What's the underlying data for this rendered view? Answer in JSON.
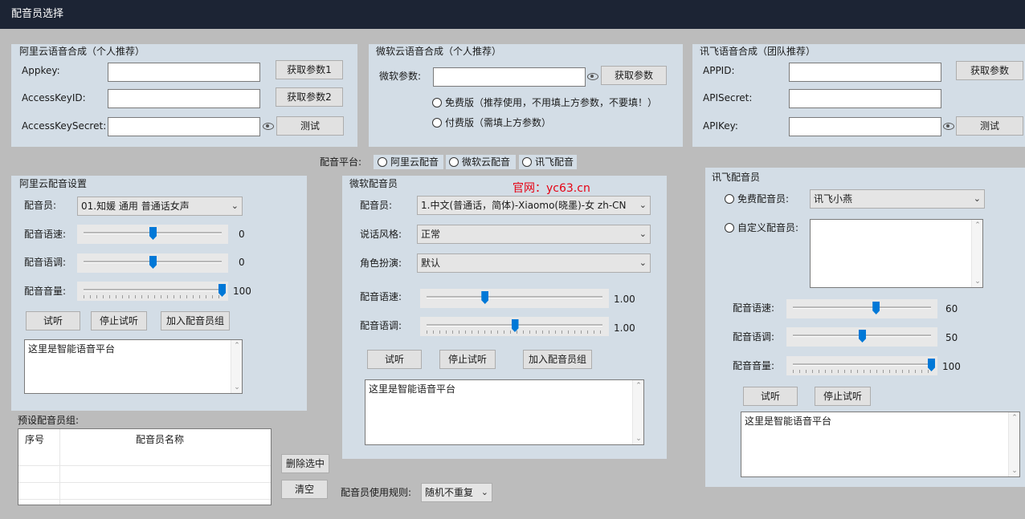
{
  "window": {
    "title": "配音员选择"
  },
  "aliyun_synth": {
    "title": "阿里云语音合成（个人推荐）",
    "appkey_label": "Appkey:",
    "appkey_value": "",
    "accesskeyid_label": "AccessKeyID:",
    "accesskeyid_value": "",
    "accesskeysecret_label": "AccessKeySecret:",
    "accesskeysecret_value": "",
    "get_params1": "获取参数1",
    "get_params2": "获取参数2",
    "test": "测试"
  },
  "microsoft_synth": {
    "title": "微软云语音合成（个人推荐）",
    "params_label": "微软参数:",
    "params_value": "",
    "get_params": "获取参数",
    "free_option": "免费版（推荐使用，不用填上方参数，不要填！）",
    "paid_option": "付费版（需填上方参数）"
  },
  "xunfei_synth": {
    "title": "讯飞语音合成（团队推荐）",
    "appid_label": "APPID:",
    "appid_value": "",
    "apisecret_label": "APISecret:",
    "apisecret_value": "",
    "apikey_label": "APIKey:",
    "apikey_value": "",
    "get_params": "获取参数",
    "test": "测试"
  },
  "platform": {
    "label": "配音平台:",
    "options": [
      "阿里云配音",
      "微软云配音",
      "讯飞配音"
    ]
  },
  "watermark": "官网：yc63.cn",
  "aliyun_voice": {
    "title": "阿里云配音设置",
    "voice_label": "配音员:",
    "voice_value": "01.知媛 通用 普通话女声",
    "speed_label": "配音语速:",
    "speed_value": "0",
    "speed_level": 0.5,
    "pitch_label": "配音语调:",
    "pitch_value": "0",
    "pitch_level": 0.5,
    "volume_label": "配音音量:",
    "volume_value": "100",
    "volume_level": 1.0,
    "listen": "试听",
    "stop": "停止试听",
    "add_group": "加入配音员组",
    "text": "这里是智能语音平台"
  },
  "microsoft_voice": {
    "title": "微软配音员",
    "voice_label": "配音员:",
    "voice_value": "1.中文(普通话，简体)-Xiaomo(晓墨)-女 zh-CN",
    "style_label": "说话风格:",
    "style_value": "正常",
    "role_label": "角色扮演:",
    "role_value": "默认",
    "speed_label": "配音语速:",
    "speed_value": "1.00",
    "speed_level": 0.33,
    "pitch_label": "配音语调:",
    "pitch_value": "1.00",
    "pitch_level": 0.5,
    "listen": "试听",
    "stop": "停止试听",
    "add_group": "加入配音员组",
    "text": "这里是智能语音平台"
  },
  "xunfei_voice": {
    "title": "讯飞配音员",
    "free_label": "免费配音员:",
    "free_value": "讯飞小燕",
    "custom_label": "自定义配音员:",
    "custom_value": "",
    "speed_label": "配音语速:",
    "speed_value": "60",
    "speed_level": 0.6,
    "pitch_label": "配音语调:",
    "pitch_value": "50",
    "pitch_level": 0.5,
    "volume_label": "配音音量:",
    "volume_value": "100",
    "volume_level": 1.0,
    "listen": "试听",
    "stop": "停止试听",
    "text": "这里是智能语音平台"
  },
  "preset_group": {
    "title": "预设配音员组:",
    "col_index": "序号",
    "col_name": "配音员名称",
    "delete_selected": "删除选中",
    "clear": "清空"
  },
  "usage_rule": {
    "label": "配音员使用规则:",
    "value": "随机不重复"
  }
}
